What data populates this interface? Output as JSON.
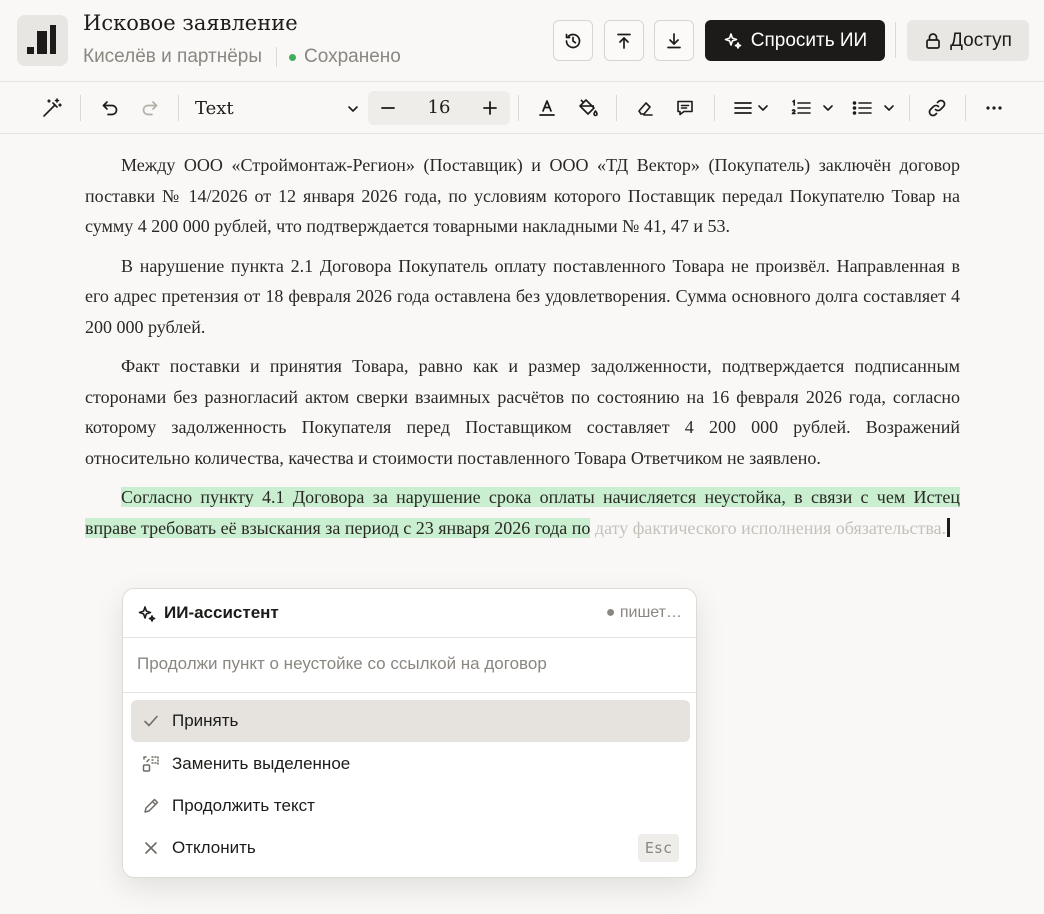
{
  "header": {
    "title": "Исковое заявление",
    "organization": "Киселёв и партнёры",
    "save_status": "Сохранено",
    "ask_ai_label": "Спросить ИИ",
    "access_label": "Доступ"
  },
  "toolbar": {
    "font_family": "Text",
    "font_size": "16"
  },
  "document": {
    "p1": "Между ООО «Строймонтаж-Регион» (Поставщик) и ООО «ТД Вектор» (Покупатель) заключён договор поставки № 14/2026 от 12 января 2026 года, по условиям которого Поставщик передал Покупателю Товар на сумму 4 200 000 рублей, что подтверждается товарными накладными № 41, 47 и 53.",
    "p2": "В нарушение пункта 2.1 Договора Покупатель оплату поставленного Товара не произвёл. Направленная в его адрес претензия от 18 февраля 2026 года оставлена без удовлетворения. Сумма основного долга составляет 4 200 000 рублей.",
    "p3": "Факт поставки и принятия Товара, равно как и размер задолженности, подтверждается подписанным сторонами без разногласий актом сверки взаимных расчётов по состоянию на 16 февраля 2026 года, согласно которому задолженность Покупателя перед Поставщиком составляет 4 200 000 рублей. Возражений относительно количества, качества и стоимости поставленного Товара Ответчиком не заявлено.",
    "p4_highlighted": "Согласно пункту 4.1 Договора за нарушение срока оплаты начисляется неустойка, в связи с чем Истец вправе требовать её взыскания за период с 23 января 2026 года по",
    "p4_suggestion": " дату фактического исполнения обязательства."
  },
  "ai_panel": {
    "title": "ИИ-ассистент",
    "status": "● пишет…",
    "prompt": "Продолжи пункт о неустойке со ссылкой на договор",
    "actions": [
      {
        "label": "Принять"
      },
      {
        "label": "Заменить выделенное"
      },
      {
        "label": "Продолжить текст"
      },
      {
        "label": "Отклонить",
        "shortcut": "Esc"
      }
    ]
  },
  "colors": {
    "accent_dark": "#1c1b19",
    "highlight": "#c9efd0",
    "saved_dot": "#3fae5a"
  }
}
